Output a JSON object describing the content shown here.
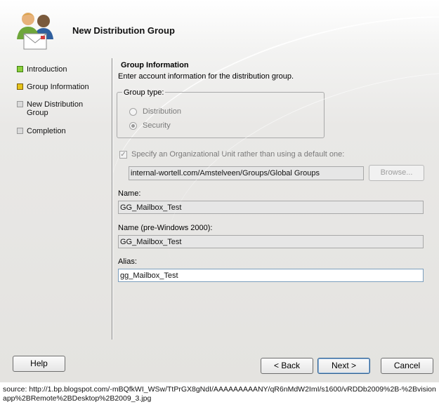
{
  "window": {
    "title": "New Distribution Group"
  },
  "steps": [
    {
      "label": "Introduction",
      "state": "done"
    },
    {
      "label": "Group Information",
      "state": "current"
    },
    {
      "label": "New Distribution Group",
      "state": "todo"
    },
    {
      "label": "Completion",
      "state": "todo"
    }
  ],
  "group_info": {
    "title": "Group Information",
    "description": "Enter account information for the distribution group.",
    "group_type_label": "Group type:",
    "options": [
      {
        "label": "Distribution",
        "checked": false
      },
      {
        "label": "Security",
        "checked": true
      }
    ],
    "ou_checkbox_label": "Specify an Organizational Unit rather than using a default one:",
    "ou_checked": true,
    "ou_value": "internal-wortell.com/Amstelveen/Groups/Global Groups",
    "browse_label": "Browse...",
    "name_label": "Name:",
    "name_value": "GG_Mailbox_Test",
    "prewin_label": "Name (pre-Windows 2000):",
    "prewin_value": "GG_Mailbox_Test",
    "alias_label": "Alias:",
    "alias_value": "gg_Mailbox_Test"
  },
  "buttons": {
    "help": "Help",
    "back": "< Back",
    "next": "Next >",
    "cancel": "Cancel"
  },
  "source_caption": "source: http://1.bp.blogspot.com/-mBQfkWI_WSw/TtPrGX8gNdI/AAAAAAAAANY/qR6nMdW2ImI/s1600/vRDDb2009%2B-%2Bvisionapp%2BRemote%2BDesktop%2B2009_3.jpg",
  "icons": {
    "wizard": "users-mail-icon",
    "check": "check-icon"
  },
  "colors": {
    "step_done": "#8ccf3c",
    "step_current": "#e5c31a",
    "step_todo": "#dadada"
  }
}
